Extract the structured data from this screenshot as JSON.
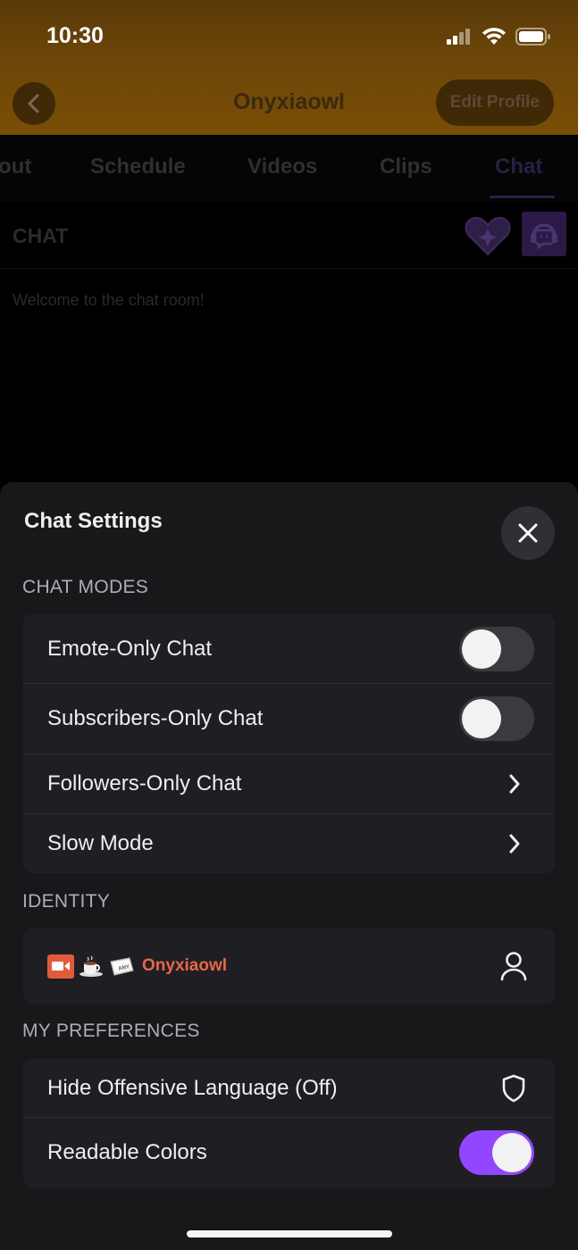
{
  "status_bar": {
    "time": "10:30"
  },
  "header": {
    "profile_name": "Onyxiaowl",
    "edit_profile_label": "Edit Profile"
  },
  "tabs": [
    {
      "label": "About",
      "visible_label": "out",
      "active": false
    },
    {
      "label": "Schedule",
      "active": false
    },
    {
      "label": "Videos",
      "active": false
    },
    {
      "label": "Clips",
      "active": false
    },
    {
      "label": "Chat",
      "active": true
    }
  ],
  "chat": {
    "title": "CHAT",
    "welcome_message": "Welcome to the chat room!"
  },
  "settings_sheet": {
    "title": "Chat Settings",
    "sections": {
      "chat_modes": {
        "label": "CHAT MODES",
        "rows": [
          {
            "label": "Emote-Only Chat",
            "control": "toggle",
            "value": false
          },
          {
            "label": "Subscribers-Only Chat",
            "control": "toggle",
            "value": false
          },
          {
            "label": "Followers-Only Chat",
            "control": "chevron"
          },
          {
            "label": "Slow Mode",
            "control": "chevron"
          }
        ]
      },
      "identity": {
        "label": "IDENTITY",
        "badges": [
          "broadcaster-badge",
          "coffee-badge",
          "any-key-badge"
        ],
        "username": "Onyxiaowl",
        "username_color": "#e8674a"
      },
      "preferences": {
        "label": "MY PREFERENCES",
        "rows": [
          {
            "label": "Hide Offensive Language (Off)",
            "control": "shield-icon"
          },
          {
            "label": "Readable Colors",
            "control": "toggle",
            "value": true
          }
        ]
      }
    }
  },
  "colors": {
    "accent": "#9147ff",
    "header_gradient": "#6b4508",
    "sheet_bg": "#18181b",
    "card_bg": "#1f1f23"
  }
}
